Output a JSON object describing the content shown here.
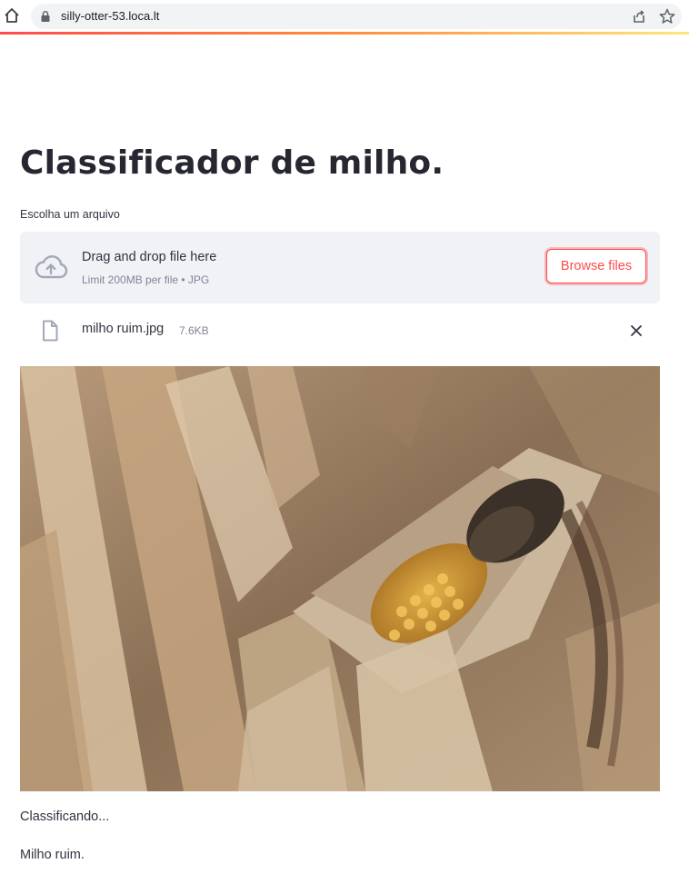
{
  "browser": {
    "url": "silly-otter-53.loca.lt",
    "icons": [
      "home-icon",
      "lock-icon",
      "share-icon",
      "star-icon"
    ]
  },
  "app": {
    "title": "Classificador de milho.",
    "uploader": {
      "label": "Escolha um arquivo",
      "drop_title": "Drag and drop file here",
      "drop_limit": "Limit 200MB per file • JPG",
      "browse_label": "Browse files",
      "icon": "cloud-upload-icon"
    },
    "uploaded_file": {
      "name": "milho ruim.jpg",
      "size": "7.6KB",
      "icon": "file-icon",
      "remove_icon": "close-icon"
    },
    "status": "Classificando...",
    "result": "Milho  ruim."
  },
  "colors": {
    "accent": "#ff4b4b",
    "dropzone_bg": "#f0f2f6",
    "text": "#31333f",
    "muted": "#808495"
  }
}
